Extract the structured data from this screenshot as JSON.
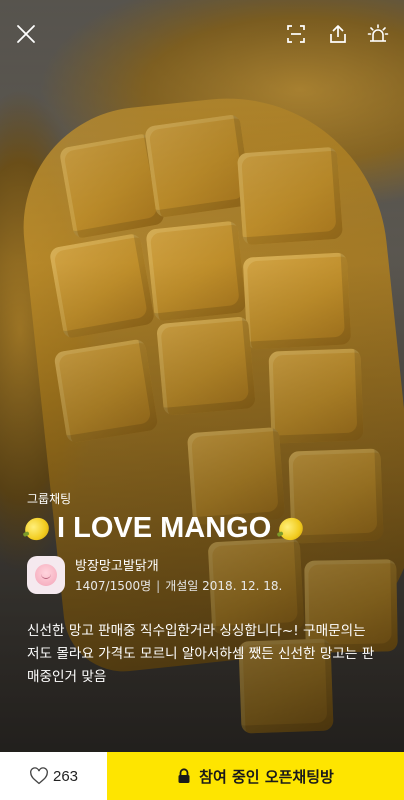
{
  "header": {
    "close_icon": "close-icon",
    "fullscreen_icon": "fullscreen-icon",
    "share_icon": "share-icon",
    "report_icon": "siren-icon"
  },
  "room": {
    "type_label": "그룹채팅",
    "title": "I LOVE MANGO",
    "title_emoji": "lemon",
    "owner_name": "방장망고발닭개",
    "members": "1407/1500명",
    "opened": "개설일 2018. 12. 18.",
    "description": "신선한 망고 판매중 직수입한거라 싱싱합니다~! 구매문의는 저도 몰라요 가격도 모르니 알아서하셈 쨌든 신선한 망고는 판매중인거 맞음"
  },
  "footer": {
    "like_count": "263",
    "join_label": "참여 중인 오픈채팅방"
  },
  "colors": {
    "join_bg": "#fee500",
    "like_bg": "#ffffff"
  }
}
